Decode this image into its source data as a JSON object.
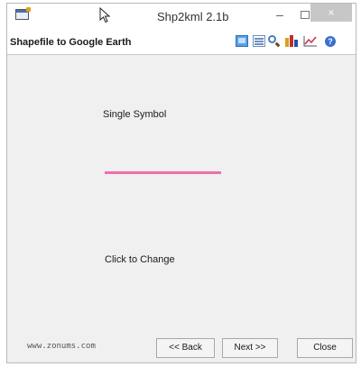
{
  "window": {
    "title": "Shp2kml 2.1b",
    "controls": {
      "minimize": "–",
      "close": "×"
    }
  },
  "header": {
    "title": "Shapefile to Google Earth",
    "toolbar_icons": [
      "layer-icon",
      "table-icon",
      "zoom-icon",
      "chart-icon",
      "graph-icon",
      "help-icon"
    ],
    "help_glyph": "?"
  },
  "main": {
    "symbol_label": "Single Symbol",
    "symbol_color": "#ee6fae",
    "change_label": "Click to Change"
  },
  "footer": {
    "url": "www.zonums.com",
    "back_label": "<< Back",
    "next_label": "Next >>",
    "close_label": "Close"
  }
}
